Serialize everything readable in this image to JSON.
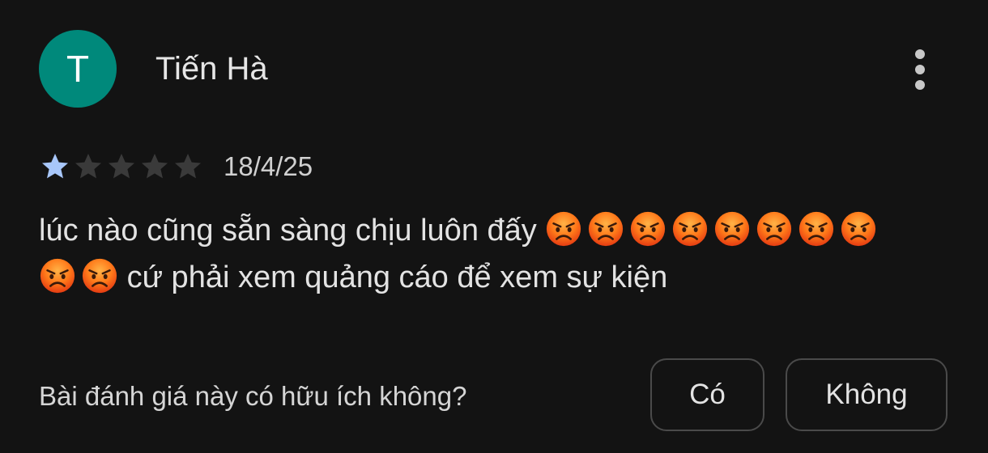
{
  "review": {
    "avatar_letter": "T",
    "avatar_color": "#00897b",
    "reviewer_name": "Tiến Hà",
    "more_icon": "more-vert-icon",
    "rating": 1,
    "rating_max": 5,
    "star_filled_color": "#a8c7fa",
    "star_empty_color": "#3a3a3a",
    "date": "18/4/25",
    "text_part1": "lúc nào cũng sẵn sàng chịu luôn đấy",
    "emoji_row1_count": 8,
    "emoji_row2_count": 2,
    "emoji": "angry-face-emoji",
    "text_part2": "cứ phải xem quảng cáo để xem sự kiện"
  },
  "helpful": {
    "question": "Bài đánh giá này có hữu ích không?",
    "yes_label": "Có",
    "no_label": "Không"
  }
}
